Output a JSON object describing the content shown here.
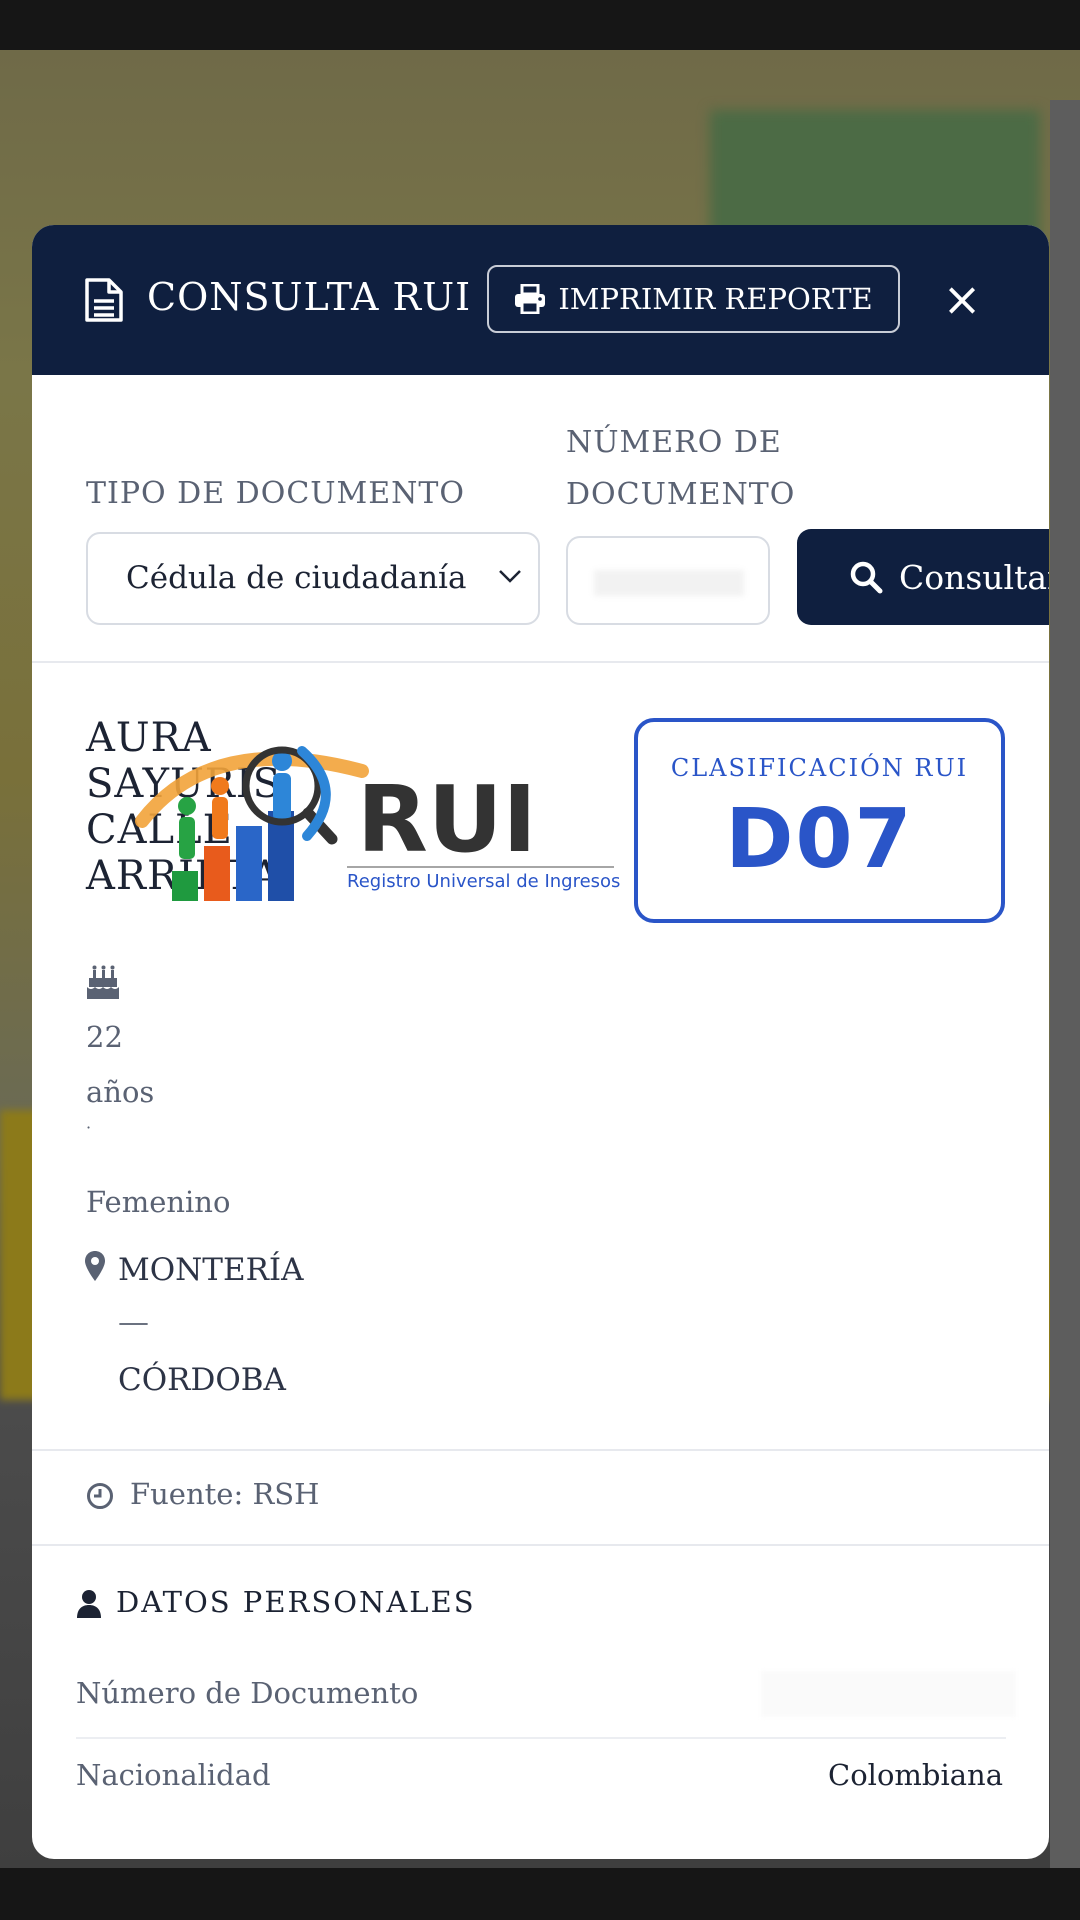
{
  "header": {
    "title": "CONSULTA RUI",
    "print_label": "IMPRIMIR REPORTE",
    "close_glyph": "×"
  },
  "form": {
    "tipo_label": "TIPO DE DOCUMENTO",
    "tipo_value": "Cédula de ciudadanía",
    "numero_label": "NÚMERO DE DOCUMENTO",
    "consultar_label": "Consultar"
  },
  "person": {
    "name": "AURA SAYURIS CALLE ARRIETA",
    "age": "22",
    "age_unit": "años",
    "separator": "·",
    "gender": "Femenino",
    "city": "MONTERÍA",
    "location_separator": "—",
    "department": "CÓRDOBA"
  },
  "logo": {
    "text": "RUI",
    "subtitle": "Registro Universal de Ingresos"
  },
  "classification": {
    "label": "CLASIFICACIÓN RUI",
    "value": "D07",
    "color": "#2a55c8"
  },
  "source": {
    "label": "Fuente: RSH"
  },
  "personal": {
    "title": "DATOS PERSONALES",
    "rows": [
      {
        "label": "Número de Documento",
        "value": ""
      },
      {
        "label": "Nacionalidad",
        "value": "Colombiana"
      }
    ]
  },
  "theme": {
    "header_bg": "#0f1f3f",
    "accent": "#2a55c8"
  },
  "icons": {
    "header": "document-icon",
    "print": "printer-icon",
    "search": "search-icon",
    "birthday": "birthday-cake-icon",
    "location": "map-pin-icon",
    "source": "clock-icon",
    "personal": "user-icon"
  }
}
